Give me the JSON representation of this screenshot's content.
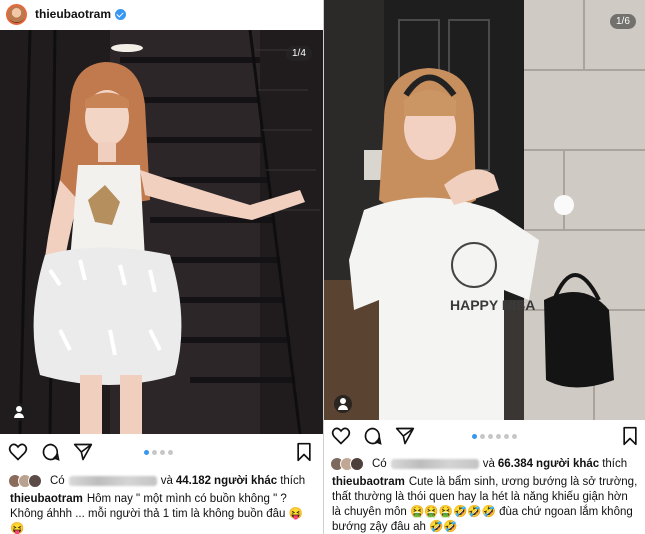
{
  "left_post": {
    "username": "thieubaotram",
    "slide_counter": "1/4",
    "likes": {
      "prefix": "Có",
      "count": "44.182",
      "others_label": "người khác",
      "suffix": "thích"
    },
    "caption_user": "thieubaotram",
    "caption_text": "Hôm nay \" một mình có buồn không \" ? Không áhhh ... mỗi người thả 1 tim là không buồn đâu 😝😝",
    "carousel_dots": 4,
    "active_dot": 0
  },
  "right_post": {
    "slide_counter": "1/6",
    "likes": {
      "prefix": "Có",
      "count": "66.384",
      "others_label": "người khác",
      "suffix": "thích"
    },
    "caption_user": "thieubaotram",
    "caption_text": "Cute là bẩm sinh, ương bướng là sở trường, thất thường là thói quen hay la hét là năng khiếu giận hờn là chuyên môn 🤮🤮🤮🤣🤣🤣 đùa chứ ngoan lắm không bướng zậy đâu ah 🤣🤣",
    "carousel_dots": 6,
    "active_dot": 0
  },
  "shirt_print": "HAPPY NISA",
  "colors": {
    "verified": "#3897f0",
    "active_dot": "#3897f0",
    "inactive_dot": "#c7c7c7",
    "avatar_ring": "#e6683c"
  },
  "icons": [
    "heart-icon",
    "comment-icon",
    "share-icon",
    "bookmark-icon",
    "verified-icon",
    "tag-people-icon"
  ]
}
